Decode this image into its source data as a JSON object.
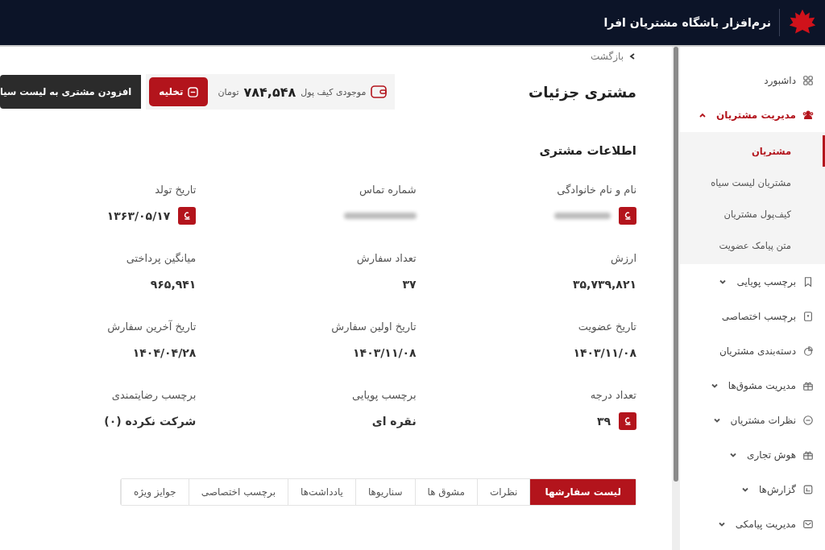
{
  "header": {
    "title": "نرم‌افزار باشگاه مشتریان افرا"
  },
  "sidebar": {
    "items": [
      {
        "label": "داشبورد"
      },
      {
        "label": "مدیریت مشتریان",
        "active": true,
        "expanded": true,
        "children": [
          {
            "label": "مشتریان",
            "selected": true
          },
          {
            "label": "مشتریان لیست سیاه",
            "selected": false
          },
          {
            "label": "کیف‌پول مشتریان",
            "selected": false
          },
          {
            "label": "متن پیامک عضویت",
            "selected": false
          }
        ]
      },
      {
        "label": "برچسب پویایی",
        "active": false,
        "expanded": false
      },
      {
        "label": "برچسب اختصاصی"
      },
      {
        "label": "دسته‌بندی مشتریان"
      },
      {
        "label": "مدیریت مشوق‌ها",
        "active": false,
        "expanded": false
      },
      {
        "label": "نظرات مشتریان",
        "active": false,
        "expanded": false
      },
      {
        "label": "هوش تجاری",
        "active": false,
        "expanded": false
      },
      {
        "label": "گزارش‌ها",
        "active": false,
        "expanded": false
      },
      {
        "label": "مدیریت پیامکی",
        "active": false,
        "expanded": false
      }
    ]
  },
  "page": {
    "back": "بازگشت",
    "title": "مشتری جزئیات",
    "wallet": {
      "label": "موجودی کیف پول",
      "amount": "۷۸۴,۵۴۸",
      "unit": "تومان",
      "button": "تخلیه"
    },
    "blacklist_button": "افزودن مشتری به لیست سیا"
  },
  "section": {
    "title": "اطلاعات مشتری",
    "fields": [
      {
        "label": "نام و نام خانوادگی",
        "redacted": true,
        "editable": true
      },
      {
        "label": "شماره تماس",
        "redacted": true,
        "editable": false
      },
      {
        "label": "تاریخ تولد",
        "value": "۱۳۶۳/۰۵/۱۷",
        "editable": true
      },
      {
        "label": "ارزش",
        "value": "۳۵,۷۳۹,۸۲۱",
        "editable": false
      },
      {
        "label": "تعداد سفارش",
        "value": "۳۷",
        "editable": false
      },
      {
        "label": "میانگین پرداختی",
        "value": "۹۶۵,۹۴۱",
        "editable": false
      },
      {
        "label": "تاریخ عضویت",
        "value": "۱۴۰۳/۱۱/۰۸",
        "editable": false
      },
      {
        "label": "تاریخ اولین سفارش",
        "value": "۱۴۰۳/۱۱/۰۸",
        "editable": false
      },
      {
        "label": "تاریخ آخرین سفارش",
        "value": "۱۴۰۴/۰۴/۲۸",
        "editable": false
      },
      {
        "label": "تعداد درجه",
        "value": "۳۹",
        "editable": true
      },
      {
        "label": "برچسب پویایی",
        "value": "نقره ای",
        "editable": false
      },
      {
        "label": "برچسب رضایتمندی",
        "value": "شرکت نکرده (۰)",
        "editable": false
      }
    ]
  },
  "tabs": [
    {
      "label": "لیست سفارشها",
      "selected": true
    },
    {
      "label": "نظرات",
      "selected": false
    },
    {
      "label": "مشوق ها",
      "selected": false
    },
    {
      "label": "سناریوها",
      "selected": false
    },
    {
      "label": "یادداشت‌ها",
      "selected": false
    },
    {
      "label": "برچسب اختصاصی",
      "selected": false
    },
    {
      "label": "جوایز ویژه",
      "selected": false
    }
  ]
}
